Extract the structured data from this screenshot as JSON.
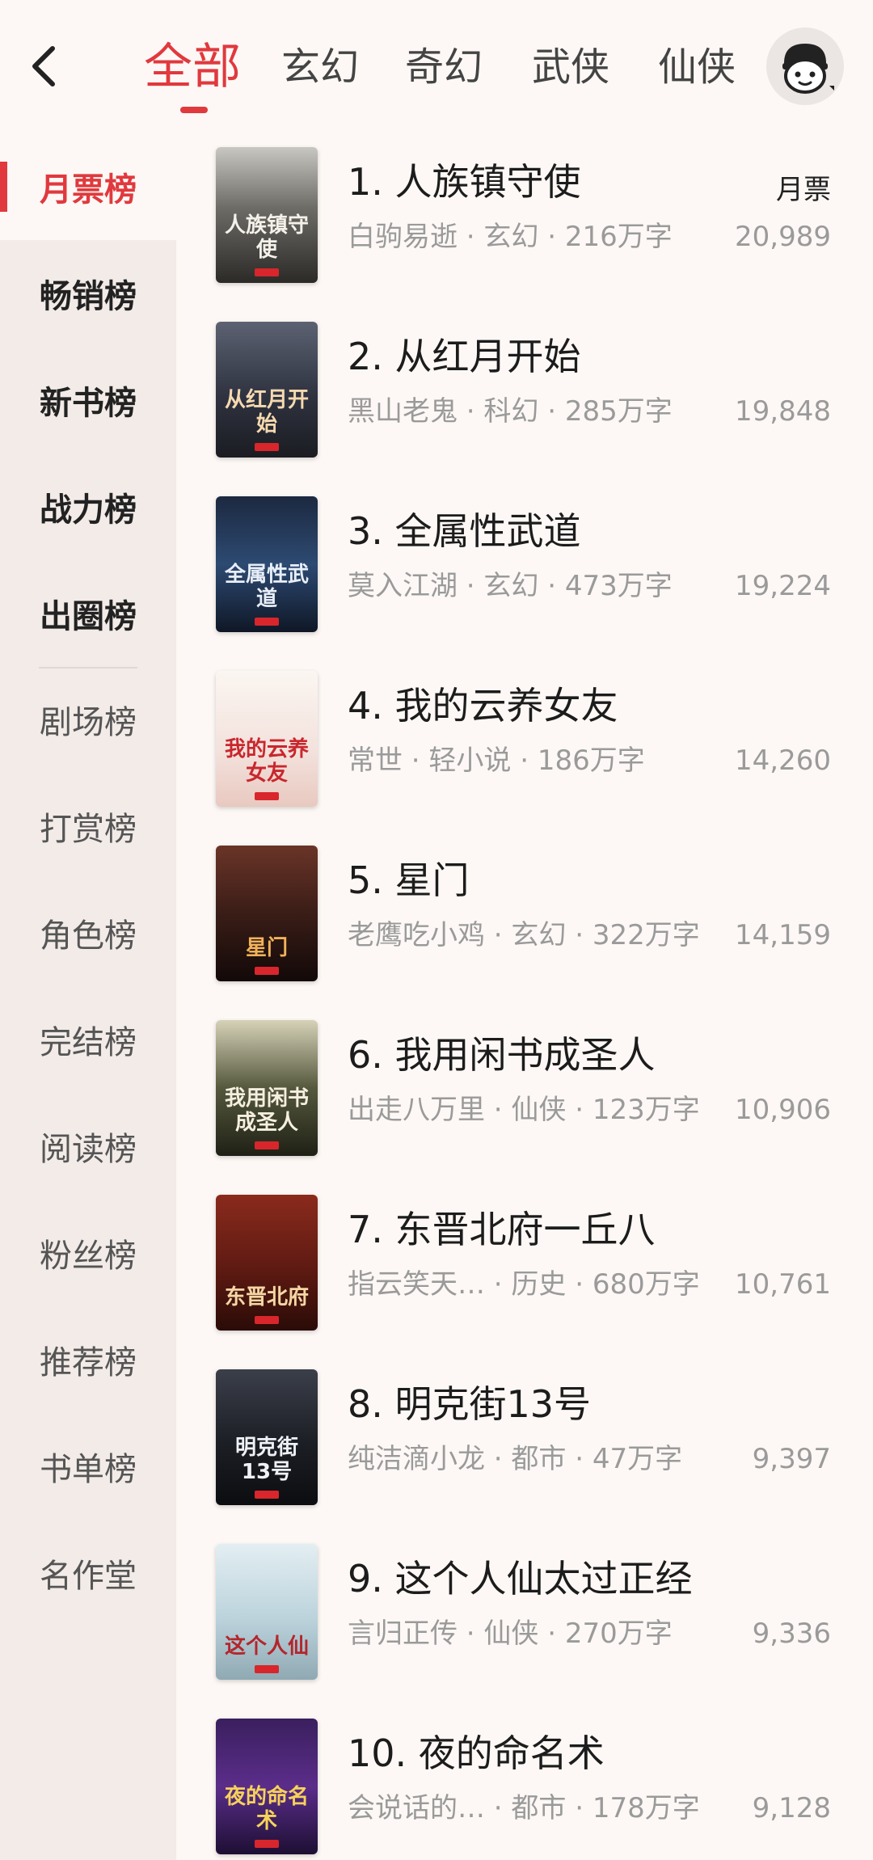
{
  "topbar": {
    "tabs": [
      "全部",
      "玄幻",
      "奇幻",
      "武侠",
      "仙侠"
    ]
  },
  "sidebar": {
    "items": [
      "月票榜",
      "畅销榜",
      "新书榜",
      "战力榜",
      "出圈榜",
      "剧场榜",
      "打赏榜",
      "角色榜",
      "完结榜",
      "阅读榜",
      "粉丝榜",
      "推荐榜",
      "书单榜",
      "名作堂"
    ]
  },
  "list": {
    "votes_label": "月票",
    "books": [
      {
        "title": "1. 人族镇守使",
        "meta": "白驹易逝 · 玄幻 · 216万字",
        "votes": "20,989",
        "cover_text": "人族镇守使"
      },
      {
        "title": "2. 从红月开始",
        "meta": "黑山老鬼 · 科幻 · 285万字",
        "votes": "19,848",
        "cover_text": "从红月开始"
      },
      {
        "title": "3. 全属性武道",
        "meta": "莫入江湖 · 玄幻 · 473万字",
        "votes": "19,224",
        "cover_text": "全属性武道"
      },
      {
        "title": "4. 我的云养女友",
        "meta": "常世 · 轻小说 · 186万字",
        "votes": "14,260",
        "cover_text": "我的云养女友"
      },
      {
        "title": "5. 星门",
        "meta": "老鹰吃小鸡 · 玄幻 · 322万字",
        "votes": "14,159",
        "cover_text": "星门"
      },
      {
        "title": "6. 我用闲书成圣人",
        "meta": "出走八万里 · 仙侠 · 123万字",
        "votes": "10,906",
        "cover_text": "我用闲书成圣人"
      },
      {
        "title": "7. 东晋北府一丘八",
        "meta": "指云笑天… · 历史 · 680万字",
        "votes": "10,761",
        "cover_text": "东晋北府"
      },
      {
        "title": "8. 明克街13号",
        "meta": "纯洁滴小龙 · 都市 · 47万字",
        "votes": "9,397",
        "cover_text": "明克街13号"
      },
      {
        "title": "9. 这个人仙太过正经",
        "meta": "言归正传 · 仙侠 · 270万字",
        "votes": "9,336",
        "cover_text": "这个人仙"
      },
      {
        "title": "10. 夜的命名术",
        "meta": "会说话的… · 都市 · 178万字",
        "votes": "9,128",
        "cover_text": "夜的命名术"
      }
    ]
  },
  "colors": {
    "accent": "#e0393e",
    "background": "#fdf8f5",
    "sidebar": "#f2ebe8"
  },
  "icons": {
    "back": "chevron-left-icon",
    "avatar": "avatar-icon"
  }
}
